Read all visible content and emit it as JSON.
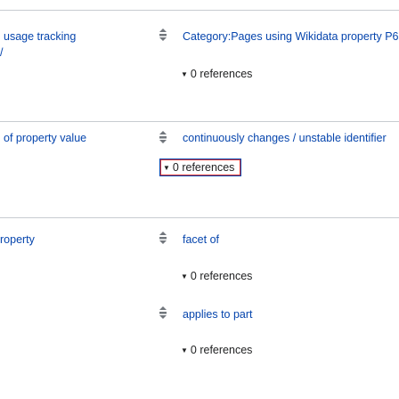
{
  "statements": [
    {
      "property_label": "usage tracking",
      "property_label_continued": "/",
      "values": [
        {
          "label": "Category:Pages using Wikidata property P6",
          "references": "0 references"
        }
      ]
    },
    {
      "property_label": "of property value",
      "values": [
        {
          "label": "continuously changes / unstable identifier",
          "references": "0 references"
        }
      ]
    },
    {
      "property_label": "roperty",
      "values": [
        {
          "label": "facet of",
          "references": "0 references"
        },
        {
          "label": "applies to part",
          "references": "0 references"
        }
      ]
    }
  ],
  "icons": {
    "rank": "rank-normal-icon",
    "references_toggle": "chevron-down-icon"
  },
  "colors": {
    "link": "#0645ad",
    "divider": "#c8ccd1",
    "focus": "#d33"
  }
}
